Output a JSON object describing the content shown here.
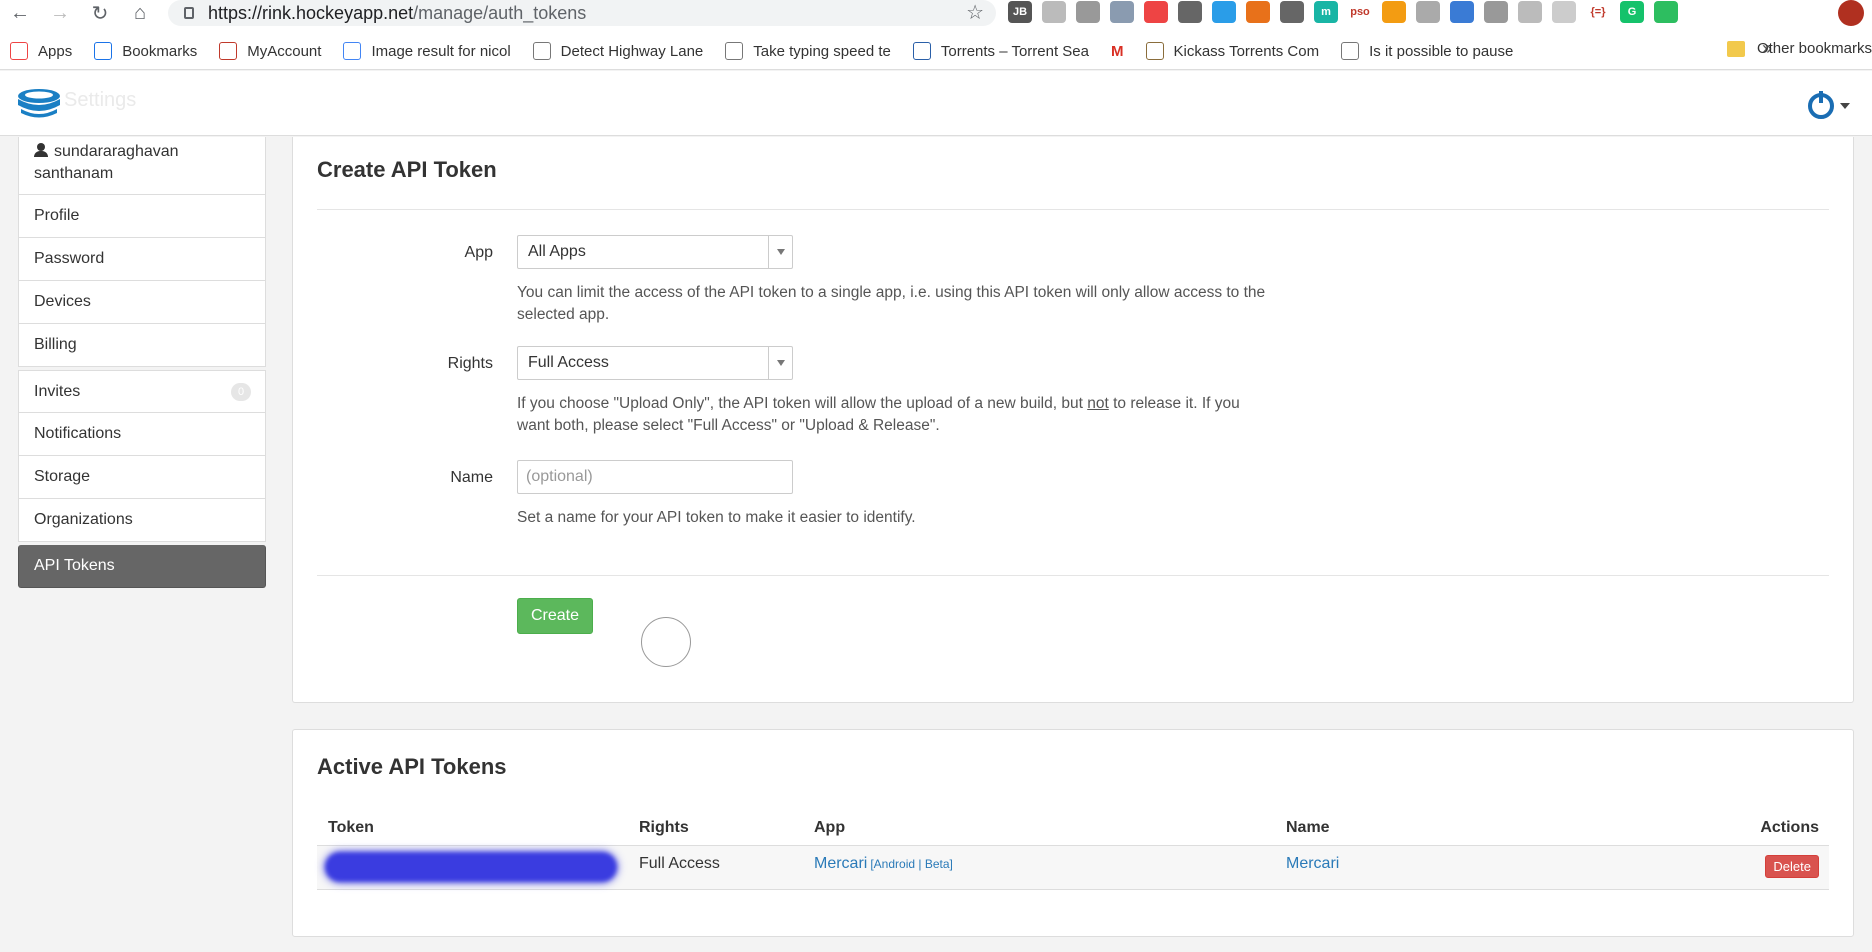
{
  "browser": {
    "url_host": "https://rink.hockeyapp.net",
    "url_path": "/manage/auth_tokens",
    "bookmarks": [
      {
        "label": "Apps",
        "icon": "apps-grid-icon"
      },
      {
        "label": "Bookmarks",
        "icon": "star-icon"
      },
      {
        "label": "MyAccount",
        "icon": "act-logo-icon"
      },
      {
        "label": "Image result for nicol",
        "icon": "google-icon"
      },
      {
        "label": "Detect Highway Lane",
        "icon": "site-icon"
      },
      {
        "label": "Take typing speed te",
        "icon": "site-icon"
      },
      {
        "label": "Torrents – Torrent Sea",
        "icon": "torrent-icon"
      },
      {
        "label": "M",
        "icon": "gmail-icon"
      },
      {
        "label": "Kickass Torrents Com",
        "icon": "kat-icon"
      },
      {
        "label": "Is it possible to pause",
        "icon": "site-icon"
      }
    ],
    "bookmarks_more": "»",
    "other_bookmarks": "Other bookmarks",
    "extensions": [
      {
        "label": "JB",
        "color": "#555"
      },
      {
        "label": "",
        "color": "#bbb"
      },
      {
        "label": "",
        "color": "#999"
      },
      {
        "label": "",
        "color": "#8a9bb0"
      },
      {
        "label": "",
        "color": "#e44"
      },
      {
        "label": "",
        "color": "#666"
      },
      {
        "label": "",
        "color": "#2a9de8"
      },
      {
        "label": "",
        "color": "#e8711a"
      },
      {
        "label": "",
        "color": "#666"
      },
      {
        "label": "m",
        "color": "#19b5a5"
      },
      {
        "label": "pso",
        "color": "#fff"
      },
      {
        "label": "",
        "color": "#f39c12"
      },
      {
        "label": "",
        "color": "#aaa"
      },
      {
        "label": "",
        "color": "#3a7bd5"
      },
      {
        "label": "",
        "color": "#999"
      },
      {
        "label": "",
        "color": "#bbb"
      },
      {
        "label": "",
        "color": "#ccc"
      },
      {
        "label": "{=}",
        "color": "#fff"
      },
      {
        "label": "G",
        "color": "#15c26b"
      },
      {
        "label": "",
        "color": "#2dbe60"
      }
    ]
  },
  "app": {
    "logo_text": "Settings"
  },
  "sidebar": {
    "user_name": "sundararaghavan santhanam",
    "items": [
      {
        "label": "Profile",
        "name": "sidebar-item-profile"
      },
      {
        "label": "Password",
        "name": "sidebar-item-password"
      },
      {
        "label": "Devices",
        "name": "sidebar-item-devices"
      },
      {
        "label": "Billing",
        "name": "sidebar-item-billing"
      }
    ],
    "items2": [
      {
        "label": "Invites",
        "name": "sidebar-item-invites",
        "badge": "0"
      },
      {
        "label": "Notifications",
        "name": "sidebar-item-notifications"
      },
      {
        "label": "Storage",
        "name": "sidebar-item-storage"
      },
      {
        "label": "Organizations",
        "name": "sidebar-item-organizations"
      }
    ],
    "active_item": "API Tokens"
  },
  "create": {
    "title": "Create API Token",
    "app_label": "App",
    "app_value": "All Apps",
    "app_help": "You can limit the access of the API token to a single app, i.e. using this API token will only allow access to the selected app.",
    "rights_label": "Rights",
    "rights_value": "Full Access",
    "rights_help_1": "If you choose \"Upload Only\", the API token will allow the upload of a new build, but ",
    "rights_help_not": "not",
    "rights_help_2": " to release it. If you want both, please select \"Full Access\" or \"Upload & Release\".",
    "name_label": "Name",
    "name_placeholder": "(optional)",
    "name_help": "Set a name for your API token to make it easier to identify.",
    "create_button": "Create"
  },
  "active": {
    "title": "Active API Tokens",
    "columns": {
      "token": "Token",
      "rights": "Rights",
      "app": "App",
      "name": "Name",
      "actions": "Actions"
    },
    "rows": [
      {
        "rights": "Full Access",
        "app": "Mercari",
        "app_tags": "[Android | Beta]",
        "name": "Mercari",
        "delete": "Delete"
      }
    ]
  }
}
